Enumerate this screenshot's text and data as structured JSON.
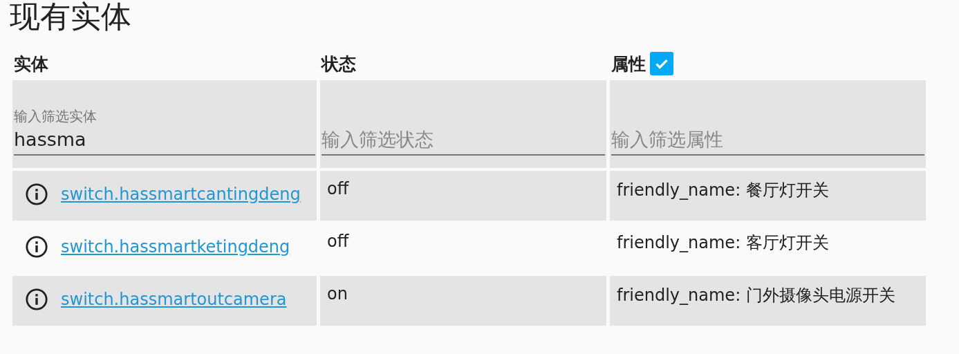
{
  "title": "现有实体",
  "columns": [
    {
      "label": "实体"
    },
    {
      "label": "状态"
    },
    {
      "label": "属性",
      "checkbox": {
        "checked": true
      }
    }
  ],
  "filters": [
    {
      "placeholder": "输入筛选实体",
      "value": "hassma"
    },
    {
      "placeholder": "输入筛选状态"
    },
    {
      "placeholder": "输入筛选属性"
    }
  ],
  "rows": [
    {
      "entity": "switch.hassmartcantingdeng",
      "state": "off",
      "attributes": "friendly_name: 餐厅灯开关"
    },
    {
      "entity": "switch.hassmartketingdeng",
      "state": "off",
      "attributes": "friendly_name: 客厅灯开关"
    },
    {
      "entity": "switch.hassmartoutcamera",
      "state": "on",
      "attributes": "friendly_name: 门外摄像头电源开关"
    }
  ]
}
